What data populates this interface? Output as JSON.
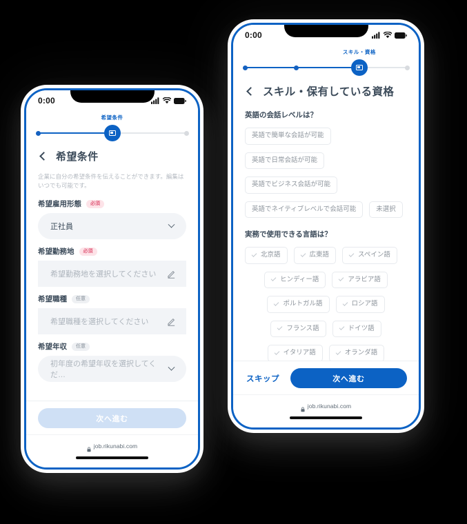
{
  "background_color": "#000000",
  "accent_color": "#0c62c4",
  "phones": {
    "left": {
      "name": "desired-conditions-screen",
      "statusbar": {
        "time": "0:00",
        "signal_icon": "signal-bars-icon",
        "wifi_icon": "wifi-icon",
        "battery_icon": "battery-icon"
      },
      "stepper": {
        "label": "希望条件",
        "total_steps": 3,
        "active_index": 1,
        "done_dots": 1
      },
      "header": {
        "back_icon": "back-chevron-icon",
        "title": "希望条件"
      },
      "lead_text": "企業に自分の希望条件を伝えることができます。編集はいつでも可能です。",
      "fields": [
        {
          "label": "希望雇用形態",
          "badge": "必須",
          "badge_kind": "required",
          "control": "select",
          "value": "正社員",
          "is_placeholder": false,
          "icon": "chevron-down-icon"
        },
        {
          "label": "希望勤務地",
          "badge": "必須",
          "badge_kind": "required",
          "control": "input",
          "value": "希望勤務地を選択してください",
          "is_placeholder": true,
          "icon": "pencil-icon"
        },
        {
          "label": "希望職種",
          "badge": "任意",
          "badge_kind": "optional",
          "control": "input",
          "value": "希望職種を選択してください",
          "is_placeholder": true,
          "icon": "pencil-icon"
        },
        {
          "label": "希望年収",
          "badge": "任意",
          "badge_kind": "optional",
          "control": "select",
          "value": "初年度の希望年収を選択してくだ…",
          "is_placeholder": true,
          "icon": "chevron-down-icon"
        }
      ],
      "footer": {
        "primary_label": "次へ進む",
        "primary_disabled": true
      },
      "urlbar": {
        "lock_icon": "lock-icon",
        "url": "job.rikunabi.com"
      }
    },
    "right": {
      "name": "skills-qualifications-screen",
      "statusbar": {
        "time": "0:00",
        "signal_icon": "signal-bars-icon",
        "wifi_icon": "wifi-icon",
        "battery_icon": "battery-icon"
      },
      "stepper": {
        "label": "スキル・資格",
        "total_steps": 4,
        "active_index": 2,
        "done_dots": 2
      },
      "header": {
        "back_icon": "back-chevron-icon",
        "title": "スキル・保有している資格"
      },
      "sections": [
        {
          "question": "英語の会話レベルは？",
          "rows": [
            [
              {
                "label": "英語で簡単な会話が可能",
                "check": false
              }
            ],
            [
              {
                "label": "英語で日常会話が可能",
                "check": false
              }
            ],
            [
              {
                "label": "英語でビジネス会話が可能",
                "check": false
              }
            ],
            [
              {
                "label": "英語でネイティブレベルで会話可能",
                "check": false
              },
              {
                "label": "未選択",
                "check": false
              }
            ]
          ]
        },
        {
          "question": "実務で使用できる言語は？",
          "rows": [
            [
              {
                "label": "北京語",
                "check": true
              },
              {
                "label": "広東語",
                "check": true
              },
              {
                "label": "スペイン語",
                "check": true
              }
            ],
            [
              {
                "label": "ヒンディー語",
                "check": true
              },
              {
                "label": "アラビア語",
                "check": true
              }
            ],
            [
              {
                "label": "ポルトガル語",
                "check": true
              },
              {
                "label": "ロシア語",
                "check": true
              }
            ],
            [
              {
                "label": "フランス語",
                "check": true
              },
              {
                "label": "ドイツ語",
                "check": true
              }
            ],
            [
              {
                "label": "イタリア語",
                "check": true
              },
              {
                "label": "オランダ語",
                "check": true
              }
            ]
          ]
        }
      ],
      "footer": {
        "skip_label": "スキップ",
        "primary_label": "次へ進む",
        "primary_disabled": false
      },
      "urlbar": {
        "lock_icon": "lock-icon",
        "url": "job.rikunabi.com"
      }
    }
  }
}
